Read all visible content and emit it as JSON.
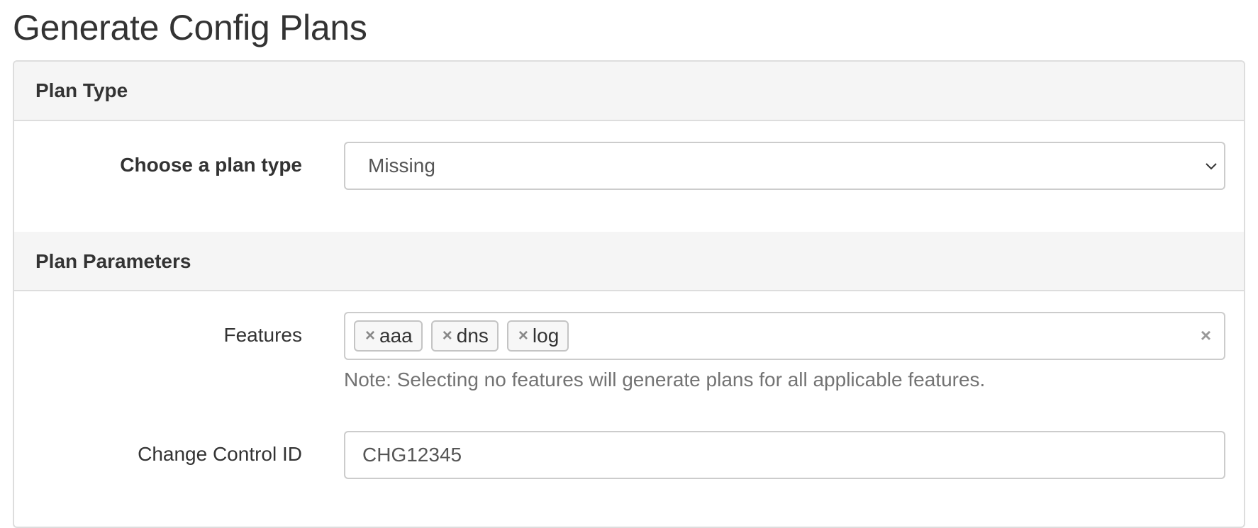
{
  "page": {
    "title": "Generate Config Plans"
  },
  "plan_type_section": {
    "heading": "Plan Type",
    "field_label": "Choose a plan type",
    "selected_value": "Missing"
  },
  "plan_parameters_section": {
    "heading": "Plan Parameters",
    "features": {
      "label": "Features",
      "tags": [
        "aaa",
        "dns",
        "log"
      ],
      "remove_glyph": "×",
      "clear_glyph": "×",
      "note": "Note: Selecting no features will generate plans for all applicable features."
    },
    "change_control": {
      "label": "Change Control ID",
      "value": "CHG12345"
    }
  },
  "icons": {
    "select_arrow": "chevron-down-icon",
    "tag_remove": "close-icon",
    "clear_all": "close-icon"
  }
}
